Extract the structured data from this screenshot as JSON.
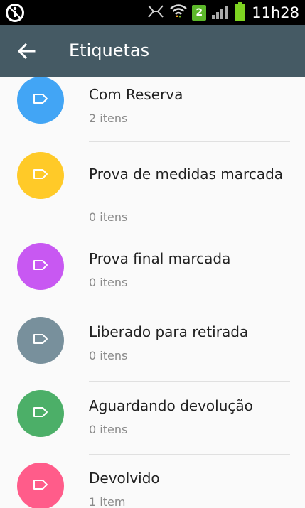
{
  "status_bar": {
    "time": "11h28",
    "sim_number": "2",
    "icons": [
      "accessibility-icon",
      "mute-icon",
      "wifi-icon",
      "sim-badge",
      "signal-icon",
      "battery-icon"
    ]
  },
  "app_bar": {
    "title": "Etiquetas",
    "back_icon": "arrow-back-icon"
  },
  "labels": [
    {
      "name": "Com Reserva",
      "count": "2 itens",
      "color": "#42a5f5"
    },
    {
      "name": "Prova de medidas marcada",
      "count": "0 itens",
      "color": "#ffca28"
    },
    {
      "name": "Prova final marcada",
      "count": "0 itens",
      "color": "#c858f2"
    },
    {
      "name": "Liberado para retirada",
      "count": "0 itens",
      "color": "#78909c"
    },
    {
      "name": "Aguardando devolução",
      "count": "0 itens",
      "color": "#4caf68"
    },
    {
      "name": "Devolvido",
      "count": "1 item",
      "color": "#ff5c8a"
    }
  ]
}
